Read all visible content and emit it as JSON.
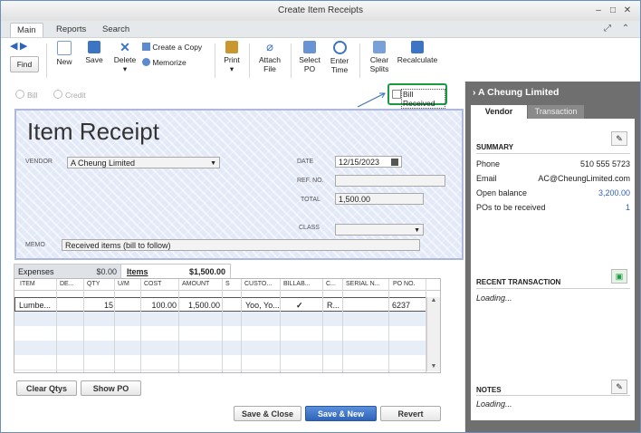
{
  "window": {
    "title": "Create Item Receipts"
  },
  "tabs": [
    {
      "label": "Main"
    },
    {
      "label": "Reports"
    },
    {
      "label": "Search"
    }
  ],
  "toolbar": {
    "find": "Find",
    "new": "New",
    "save": "Save",
    "delete": "Delete",
    "create_copy": "Create a Copy",
    "memorize": "Memorize",
    "print": "Print",
    "attach_file_1": "Attach",
    "attach_file_2": "File",
    "select_po_1": "Select",
    "select_po_2": "PO",
    "enter_time_1": "Enter",
    "enter_time_2": "Time",
    "clear_splits_1": "Clear",
    "clear_splits_2": "Splits",
    "recalculate": "Recalculate"
  },
  "radios": {
    "bill": "Bill",
    "credit": "Credit"
  },
  "bill_received": {
    "label": "Bill Received",
    "checked": false
  },
  "form": {
    "title": "Item Receipt",
    "vendor_label": "VENDOR",
    "vendor_value": "A Cheung Limited",
    "date_label": "DATE",
    "date_value": "12/15/2023",
    "ref_label": "REF. NO.",
    "ref_value": "",
    "total_label": "TOTAL",
    "total_value": "1,500.00",
    "class_label": "CLASS",
    "class_value": "",
    "memo_label": "MEMO",
    "memo_value": "Received items (bill to follow)"
  },
  "subtabs": {
    "expenses_label": "Expenses",
    "expenses_amount": "$0.00",
    "items_label": "Items",
    "items_amount": "$1,500.00"
  },
  "grid": {
    "headers": [
      "ITEM",
      "DE...",
      "QTY",
      "U/M",
      "COST",
      "AMOUNT",
      "S",
      "CUSTO...",
      "BILLAB...",
      "C...",
      "SERIAL N...",
      "PO NO."
    ],
    "rows": [
      {
        "item": "Lumbe...",
        "desc": "",
        "qty": "15",
        "um": "",
        "cost": "100.00",
        "amount": "1,500.00",
        "s": "",
        "customer": "Yoo, Yo...",
        "billable": "✓",
        "c": "R...",
        "serial": "",
        "po": "6237"
      }
    ]
  },
  "buttons": {
    "clear_qtys": "Clear Qtys",
    "show_po": "Show PO",
    "save_close": "Save & Close",
    "save_new": "Save & New",
    "revert": "Revert"
  },
  "sidepanel": {
    "title": "A Cheung Limited",
    "tab_vendor": "Vendor",
    "tab_transaction": "Transaction",
    "summary_title": "SUMMARY",
    "phone_label": "Phone",
    "phone_value": "510 555 5723",
    "email_label": "Email",
    "email_value": "AC@CheungLimited.com",
    "open_balance_label": "Open balance",
    "open_balance_value": "3,200.00",
    "pos_label": "POs to be received",
    "pos_value": "1",
    "recent_title": "RECENT TRANSACTION",
    "recent_loading": "Loading...",
    "notes_title": "NOTES",
    "notes_loading": "Loading..."
  },
  "colors": {
    "accent_green": "#1c9a42",
    "link_blue": "#2f5fb3",
    "primary_button": "#2f64b8",
    "form_background": "#e4e9f8"
  }
}
